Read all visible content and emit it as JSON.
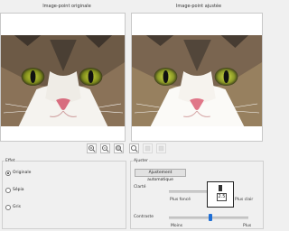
{
  "left_panel": {
    "title": "Image-point originale"
  },
  "right_panel": {
    "title": "Image-point ajustée"
  },
  "zoom_toolbar": {
    "buttons": [
      "zoom-in-icon",
      "zoom-out-icon",
      "zoom-fit-icon",
      "zoom-actual-icon",
      "disabled-icon",
      "disabled-icon"
    ]
  },
  "effect_group": {
    "title": "Effet",
    "options": [
      {
        "label": "Originale",
        "selected": true
      },
      {
        "label": "Sépia",
        "selected": false
      },
      {
        "label": "Gris",
        "selected": false
      }
    ]
  },
  "adjust_group": {
    "title": "Ajuster",
    "auto_button": "Ajustement automatique",
    "clarity": {
      "label": "Clarté",
      "min_label": "Plus foncé",
      "max_label": "Plus clair",
      "value": "2.5"
    },
    "contrast": {
      "label": "Contraste",
      "min_label": "Moins",
      "max_label": "Plus",
      "level": 0.6
    }
  },
  "colors": {
    "accent": "#1f6fd6"
  }
}
